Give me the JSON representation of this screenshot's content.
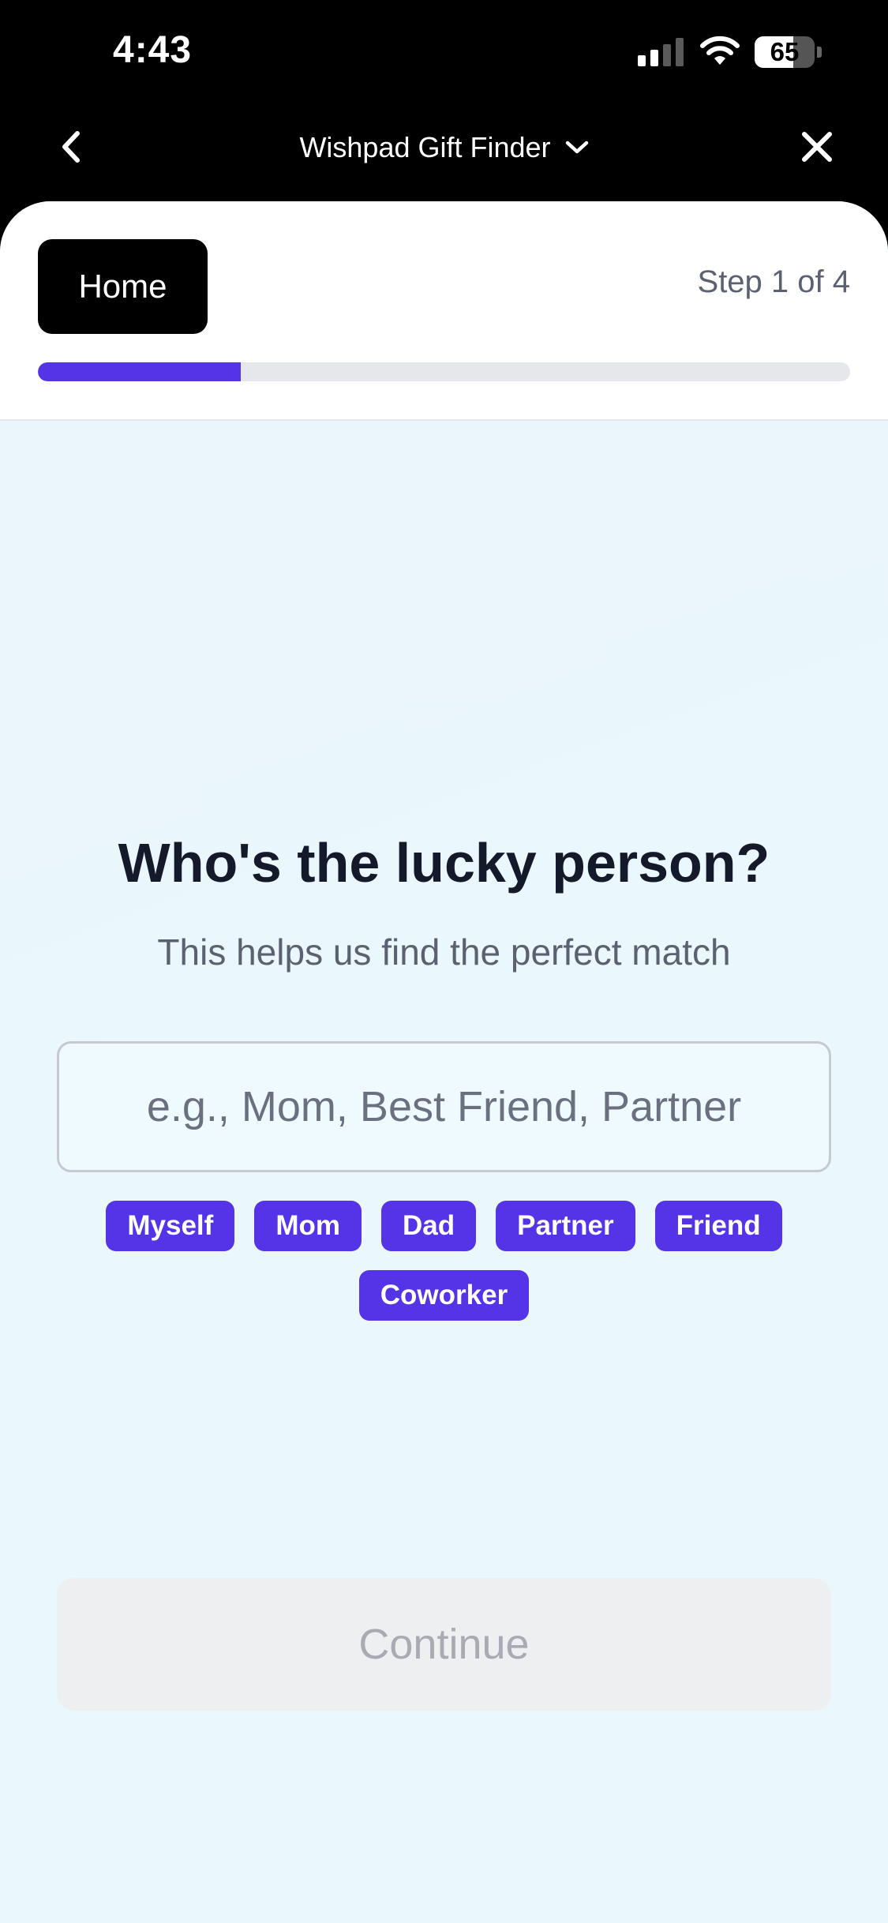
{
  "status_bar": {
    "time": "4:43",
    "battery_level": "65",
    "battery_fraction": 0.65
  },
  "nav": {
    "title": "Wishpad Gift Finder",
    "back_icon": "chevron-left-icon",
    "close_icon": "close-icon",
    "dropdown_icon": "chevron-down-icon"
  },
  "header": {
    "home_label": "Home",
    "step_label": "Step 1 of 4",
    "progress_fraction": 0.25
  },
  "main": {
    "question": "Who's the lucky person?",
    "subtitle": "This helps us find the perfect match",
    "input": {
      "placeholder": "e.g., Mom, Best Friend, Partner",
      "value": ""
    },
    "suggestions": [
      "Myself",
      "Mom",
      "Dad",
      "Partner",
      "Friend",
      "Coworker"
    ],
    "continue_label": "Continue",
    "continue_enabled": false
  },
  "colors": {
    "accent": "#5533e6",
    "background": "#eaf7fd",
    "title_text": "#141a2a",
    "secondary_text": "#5b6170",
    "disabled_button": "#eeeff1"
  }
}
